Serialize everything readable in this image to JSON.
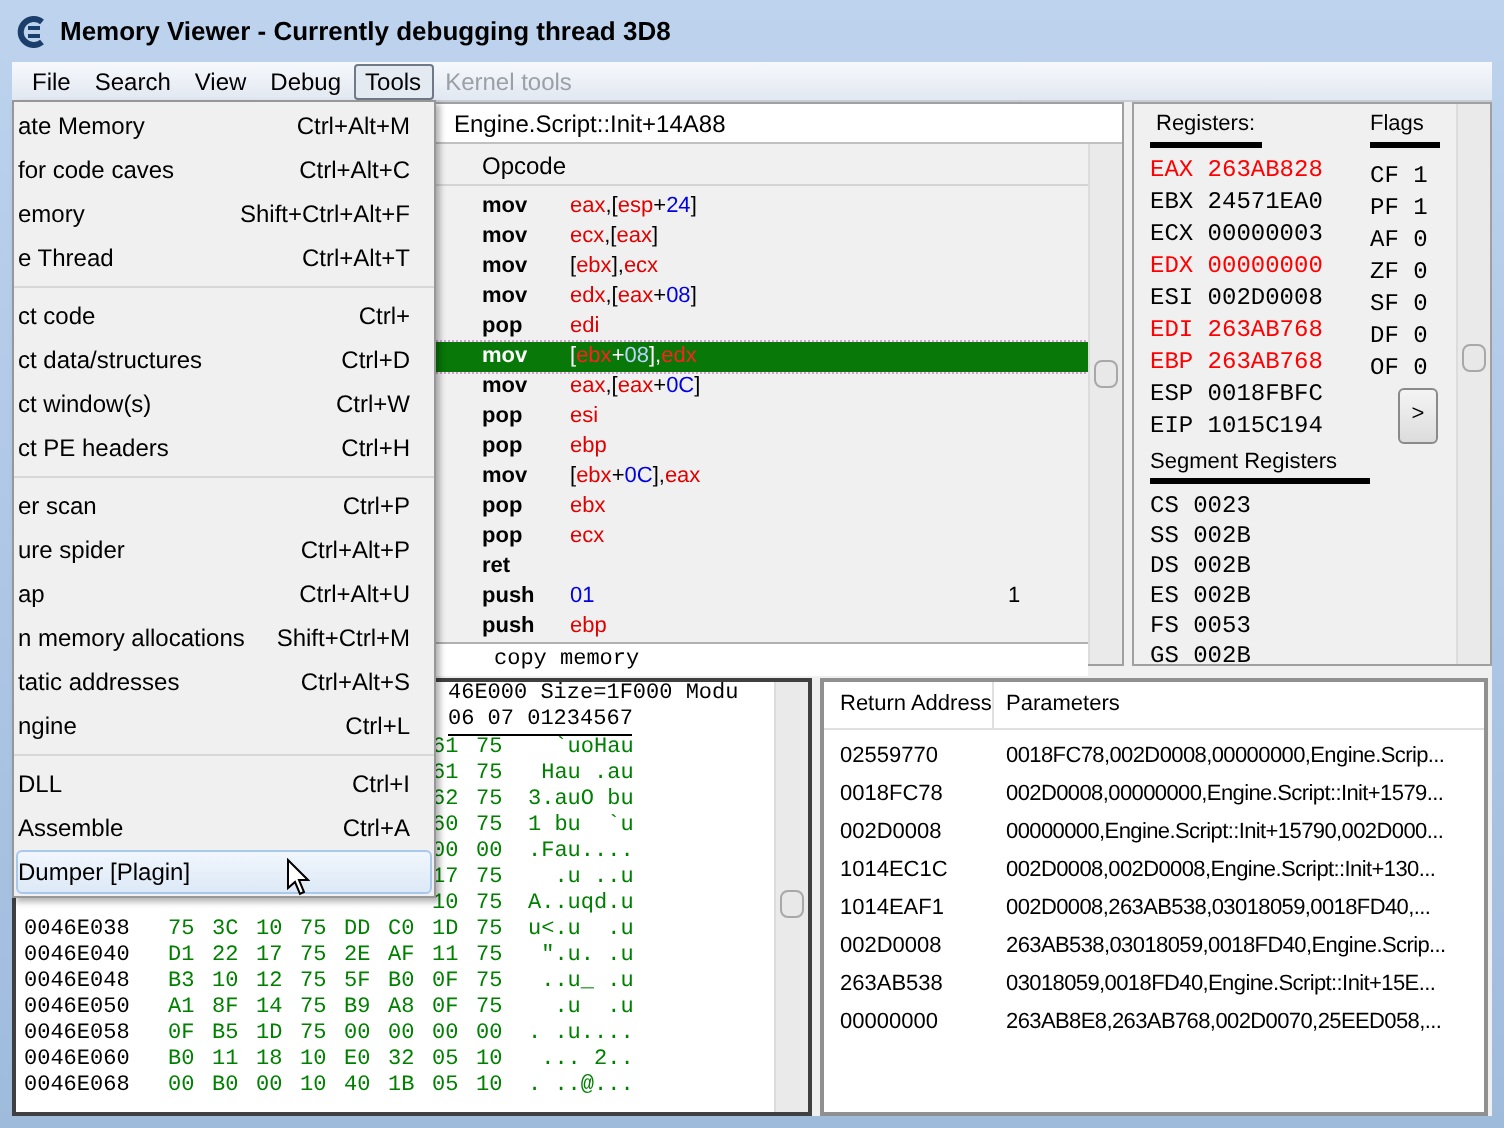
{
  "window": {
    "title": "Memory Viewer - Currently debugging thread 3D8"
  },
  "menubar": [
    {
      "label": "File",
      "selected": false,
      "disabled": false
    },
    {
      "label": "Search",
      "selected": false,
      "disabled": false
    },
    {
      "label": "View",
      "selected": false,
      "disabled": false
    },
    {
      "label": "Debug",
      "selected": false,
      "disabled": false
    },
    {
      "label": "Tools",
      "selected": true,
      "disabled": false
    },
    {
      "label": "Kernel tools",
      "selected": false,
      "disabled": true
    }
  ],
  "tools_menu": [
    [
      {
        "label": "ate Memory",
        "shortcut": "Ctrl+Alt+M",
        "selected": false
      },
      {
        "label": "for code caves",
        "shortcut": "Ctrl+Alt+C",
        "selected": false
      },
      {
        "label": "emory",
        "shortcut": "Shift+Ctrl+Alt+F",
        "selected": false
      },
      {
        "label": "e Thread",
        "shortcut": "Ctrl+Alt+T",
        "selected": false
      }
    ],
    [
      {
        "label": "ct code",
        "shortcut": "Ctrl+",
        "selected": false
      },
      {
        "label": "ct data/structures",
        "shortcut": "Ctrl+D",
        "selected": false
      },
      {
        "label": "ct window(s)",
        "shortcut": "Ctrl+W",
        "selected": false
      },
      {
        "label": "ct PE headers",
        "shortcut": "Ctrl+H",
        "selected": false
      }
    ],
    [
      {
        "label": "er scan",
        "shortcut": "Ctrl+P",
        "selected": false
      },
      {
        "label": "ure spider",
        "shortcut": "Ctrl+Alt+P",
        "selected": false
      },
      {
        "label": "ap",
        "shortcut": "Ctrl+Alt+U",
        "selected": false
      },
      {
        "label": "n memory allocations",
        "shortcut": "Shift+Ctrl+M",
        "selected": false
      },
      {
        "label": "tatic addresses",
        "shortcut": "Ctrl+Alt+S",
        "selected": false
      },
      {
        "label": "ngine",
        "shortcut": "Ctrl+L",
        "selected": false
      }
    ],
    [
      {
        "label": "DLL",
        "shortcut": "Ctrl+I",
        "selected": false
      },
      {
        "label": "Assemble",
        "shortcut": "Ctrl+A",
        "selected": false
      },
      {
        "label": "Dumper [Plagin]",
        "selected": true
      }
    ]
  ],
  "disassembler": {
    "location": "Engine.Script::Init+14A88",
    "column": "Opcode",
    "status": "copy memory",
    "rows": [
      {
        "mnemonic": "mov",
        "operands": [
          {
            "t": "eax",
            "kind": "reg"
          },
          {
            "t": ",[",
            "kind": "sym"
          },
          {
            "t": "esp",
            "kind": "reg"
          },
          {
            "t": "+",
            "kind": "sym"
          },
          {
            "t": "24",
            "kind": "num"
          },
          {
            "t": "]",
            "kind": "sym"
          }
        ],
        "selected": false
      },
      {
        "mnemonic": "mov",
        "operands": [
          {
            "t": "ecx",
            "kind": "reg"
          },
          {
            "t": ",[",
            "kind": "sym"
          },
          {
            "t": "eax",
            "kind": "reg"
          },
          {
            "t": "]",
            "kind": "sym"
          }
        ],
        "selected": false
      },
      {
        "mnemonic": "mov",
        "operands": [
          {
            "t": "[",
            "kind": "sym"
          },
          {
            "t": "ebx",
            "kind": "reg"
          },
          {
            "t": "],",
            "kind": "sym"
          },
          {
            "t": "ecx",
            "kind": "reg"
          }
        ],
        "selected": false
      },
      {
        "mnemonic": "mov",
        "operands": [
          {
            "t": "edx",
            "kind": "reg"
          },
          {
            "t": ",[",
            "kind": "sym"
          },
          {
            "t": "eax",
            "kind": "reg"
          },
          {
            "t": "+",
            "kind": "sym"
          },
          {
            "t": "08",
            "kind": "num"
          },
          {
            "t": "]",
            "kind": "sym"
          }
        ],
        "selected": false
      },
      {
        "mnemonic": "pop",
        "operands": [
          {
            "t": "edi",
            "kind": "reg"
          }
        ],
        "selected": false
      },
      {
        "mnemonic": "mov",
        "operands": [
          {
            "t": "[",
            "kind": "sym"
          },
          {
            "t": "ebx",
            "kind": "reg"
          },
          {
            "t": "+",
            "kind": "sym"
          },
          {
            "t": "08",
            "kind": "num"
          },
          {
            "t": "],",
            "kind": "sym"
          },
          {
            "t": "edx",
            "kind": "reg"
          }
        ],
        "selected": true
      },
      {
        "mnemonic": "mov",
        "operands": [
          {
            "t": "eax",
            "kind": "reg"
          },
          {
            "t": ",[",
            "kind": "sym"
          },
          {
            "t": "eax",
            "kind": "reg"
          },
          {
            "t": "+",
            "kind": "sym"
          },
          {
            "t": "0C",
            "kind": "num"
          },
          {
            "t": "]",
            "kind": "sym"
          }
        ],
        "selected": false
      },
      {
        "mnemonic": "pop",
        "operands": [
          {
            "t": "esi",
            "kind": "reg"
          }
        ],
        "selected": false
      },
      {
        "mnemonic": "pop",
        "operands": [
          {
            "t": "ebp",
            "kind": "reg"
          }
        ],
        "selected": false
      },
      {
        "mnemonic": "mov",
        "operands": [
          {
            "t": "[",
            "kind": "sym"
          },
          {
            "t": "ebx",
            "kind": "reg"
          },
          {
            "t": "+",
            "kind": "sym"
          },
          {
            "t": "0C",
            "kind": "num"
          },
          {
            "t": "],",
            "kind": "sym"
          },
          {
            "t": "eax",
            "kind": "reg"
          }
        ],
        "selected": false
      },
      {
        "mnemonic": "pop",
        "operands": [
          {
            "t": "ebx",
            "kind": "reg"
          }
        ],
        "selected": false
      },
      {
        "mnemonic": "pop",
        "operands": [
          {
            "t": "ecx",
            "kind": "reg"
          }
        ],
        "selected": false
      },
      {
        "mnemonic": "ret",
        "operands": [],
        "selected": false
      },
      {
        "mnemonic": "push",
        "operands": [
          {
            "t": "01",
            "kind": "num"
          }
        ],
        "comment": "1",
        "selected": false
      },
      {
        "mnemonic": "push",
        "operands": [
          {
            "t": "ebp",
            "kind": "reg"
          }
        ],
        "selected": false
      }
    ]
  },
  "registers": {
    "title": "Registers:",
    "items": [
      {
        "name": "EAX",
        "value": "263AB828",
        "changed": true
      },
      {
        "name": "EBX",
        "value": "24571EA0",
        "changed": false
      },
      {
        "name": "ECX",
        "value": "00000003",
        "changed": false
      },
      {
        "name": "EDX",
        "value": "00000000",
        "changed": true
      },
      {
        "name": "ESI",
        "value": "002D0008",
        "changed": false
      },
      {
        "name": "EDI",
        "value": "263AB768",
        "changed": true
      },
      {
        "name": "EBP",
        "value": "263AB768",
        "changed": true
      },
      {
        "name": "ESP",
        "value": "0018FBFC",
        "changed": false
      },
      {
        "name": "EIP",
        "value": "1015C194",
        "changed": false
      }
    ],
    "flags_title": "Flags",
    "flags": [
      {
        "name": "CF",
        "value": "1"
      },
      {
        "name": "PF",
        "value": "1"
      },
      {
        "name": "AF",
        "value": "0"
      },
      {
        "name": "ZF",
        "value": "0"
      },
      {
        "name": "SF",
        "value": "0"
      },
      {
        "name": "DF",
        "value": "0"
      },
      {
        "name": "OF",
        "value": "0"
      }
    ],
    "expand_button": ">",
    "segment_title": "Segment Registers",
    "segments": [
      {
        "name": "CS",
        "value": "0023"
      },
      {
        "name": "SS",
        "value": "002B"
      },
      {
        "name": "DS",
        "value": "002B"
      },
      {
        "name": "ES",
        "value": "002B"
      },
      {
        "name": "FS",
        "value": "0053"
      },
      {
        "name": "GS",
        "value": "002B"
      }
    ]
  },
  "hex_view": {
    "info": "46E000 Size=1F000 Modu",
    "header": "06 07 01234567",
    "rows": [
      {
        "bytes": [
          "61",
          "75"
        ],
        "ascii": "  `uoHau"
      },
      {
        "bytes": [
          "61",
          "75"
        ],
        "ascii": " Hau .au"
      },
      {
        "bytes": [
          "62",
          "75"
        ],
        "ascii": "3.auO bu"
      },
      {
        "bytes": [
          "60",
          "75"
        ],
        "ascii": "1 bu  `u"
      },
      {
        "bytes": [
          "00",
          "00"
        ],
        "ascii": ".Fau...."
      },
      {
        "bytes": [
          "17",
          "75"
        ],
        "ascii": "  .u ..u"
      },
      {
        "bytes": [
          "10",
          "75"
        ],
        "ascii": "A..uqd.u"
      },
      {
        "address": "0046E038",
        "bytes": [
          "75",
          "3C",
          "10",
          "75",
          "DD",
          "C0",
          "1D",
          "75"
        ],
        "ascii": "u<.u  .u"
      },
      {
        "address": "0046E040",
        "bytes": [
          "D1",
          "22",
          "17",
          "75",
          "2E",
          "AF",
          "11",
          "75"
        ],
        "ascii": " \".u. .u"
      },
      {
        "address": "0046E048",
        "bytes": [
          "B3",
          "10",
          "12",
          "75",
          "5F",
          "B0",
          "0F",
          "75"
        ],
        "ascii": " ..u_ .u"
      },
      {
        "address": "0046E050",
        "bytes": [
          "A1",
          "8F",
          "14",
          "75",
          "B9",
          "A8",
          "0F",
          "75"
        ],
        "ascii": "  .u  .u"
      },
      {
        "address": "0046E058",
        "bytes": [
          "0F",
          "B5",
          "1D",
          "75",
          "00",
          "00",
          "00",
          "00"
        ],
        "ascii": ". .u...."
      },
      {
        "address": "0046E060",
        "bytes": [
          "B0",
          "11",
          "18",
          "10",
          "E0",
          "32",
          "05",
          "10"
        ],
        "ascii": " ... 2.."
      },
      {
        "address": "0046E068",
        "bytes": [
          "00",
          "B0",
          "00",
          "10",
          "40",
          "1B",
          "05",
          "10"
        ],
        "ascii": ". ..@..."
      }
    ]
  },
  "stack": {
    "columns": [
      "Return Address",
      "Parameters"
    ],
    "rows": [
      [
        "02559770",
        "0018FC78,002D0008,00000000,Engine.Scrip..."
      ],
      [
        "0018FC78",
        "002D0008,00000000,Engine.Script::Init+1579..."
      ],
      [
        "002D0008",
        "00000000,Engine.Script::Init+15790,002D000..."
      ],
      [
        "1014EC1C",
        "002D0008,002D0008,Engine.Script::Init+130..."
      ],
      [
        "1014EAF1",
        "002D0008,263AB538,03018059,0018FD40,..."
      ],
      [
        "002D0008",
        "263AB538,03018059,0018FD40,Engine.Scrip..."
      ],
      [
        "263AB538",
        "03018059,0018FD40,Engine.Script::Init+15E..."
      ],
      [
        "00000000",
        "263AB8E8,263AB768,002D0070,25EED058,..."
      ]
    ]
  }
}
